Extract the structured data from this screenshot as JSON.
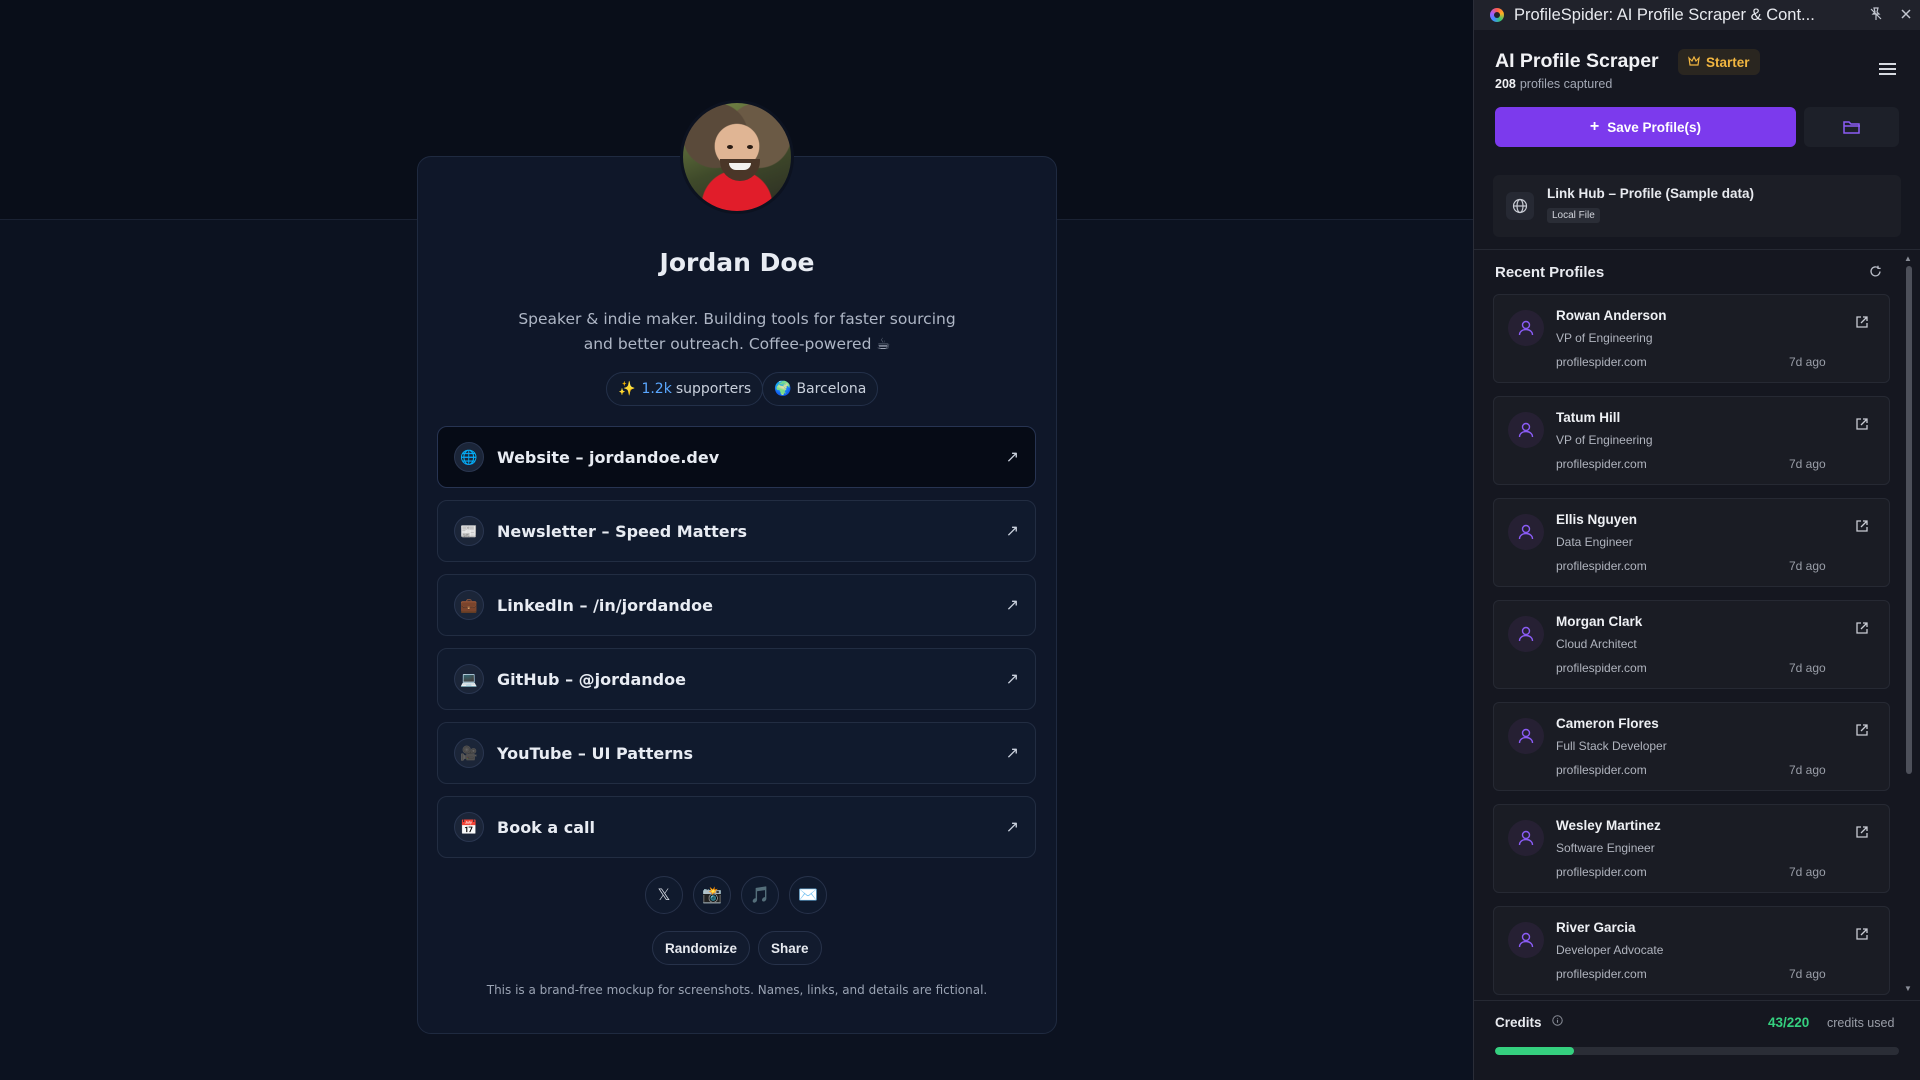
{
  "page": {
    "profile": {
      "name": "Jordan Doe",
      "bio_line1": "Speaker & indie maker. Building tools for faster sourcing",
      "bio_line2": "and better outreach. Coffee-powered ☕",
      "supporters_prefix": "✨",
      "supporters_count": "1.2k",
      "supporters_label": "supporters",
      "location_icon": "🌍",
      "location": "Barcelona"
    },
    "links": [
      {
        "icon": "🌐",
        "label": "Website – jordandoe.dev",
        "arrow": "↗"
      },
      {
        "icon": "📰",
        "label": "Newsletter – Speed Matters",
        "arrow": "↗"
      },
      {
        "icon": "💼",
        "label": "LinkedIn – /in/jordandoe",
        "arrow": "↗"
      },
      {
        "icon": "💻",
        "label": "GitHub – @jordandoe",
        "arrow": "↗"
      },
      {
        "icon": "🎥",
        "label": "YouTube – UI Patterns",
        "arrow": "↗"
      },
      {
        "icon": "📅",
        "label": "Book a call",
        "arrow": "↗"
      }
    ],
    "socials": [
      {
        "name": "x-icon",
        "glyph": "𝕏"
      },
      {
        "name": "camera-icon",
        "glyph": "📸"
      },
      {
        "name": "music-icon",
        "glyph": "🎵"
      },
      {
        "name": "mail-icon",
        "glyph": "✉️"
      }
    ],
    "buttons": {
      "randomize": "Randomize",
      "share": "Share"
    },
    "disclaimer": "This is a brand-free mockup for screenshots. Names, links, and details are fictional."
  },
  "panel": {
    "window_title": "ProfileSpider: AI Profile Scraper & Cont...",
    "app_title": "AI Profile Scraper",
    "plan": "Starter",
    "profiles_count": "208",
    "profiles_label": "profiles captured",
    "save_button": "Save Profile(s)",
    "source": {
      "title": "Link Hub – Profile (Sample data)",
      "tag": "Local File"
    },
    "recent_title": "Recent Profiles",
    "profiles": [
      {
        "name": "Rowan Anderson",
        "role": "VP of Engineering",
        "domain": "profilespider.com",
        "ago": "7d ago"
      },
      {
        "name": "Tatum Hill",
        "role": "VP of Engineering",
        "domain": "profilespider.com",
        "ago": "7d ago"
      },
      {
        "name": "Ellis Nguyen",
        "role": "Data Engineer",
        "domain": "profilespider.com",
        "ago": "7d ago"
      },
      {
        "name": "Morgan Clark",
        "role": "Cloud Architect",
        "domain": "profilespider.com",
        "ago": "7d ago"
      },
      {
        "name": "Cameron Flores",
        "role": "Full Stack Developer",
        "domain": "profilespider.com",
        "ago": "7d ago"
      },
      {
        "name": "Wesley Martinez",
        "role": "Software Engineer",
        "domain": "profilespider.com",
        "ago": "7d ago"
      },
      {
        "name": "River Garcia",
        "role": "Developer Advocate",
        "domain": "profilespider.com",
        "ago": "7d ago"
      }
    ],
    "credits": {
      "label": "Credits",
      "value": "43/220",
      "suffix": "credits used",
      "used": 43,
      "total": 220
    }
  },
  "colors": {
    "accent": "#7c3aed",
    "credits": "#35d07f",
    "plan": "#f2b640",
    "link_num": "#5aa7ff"
  }
}
